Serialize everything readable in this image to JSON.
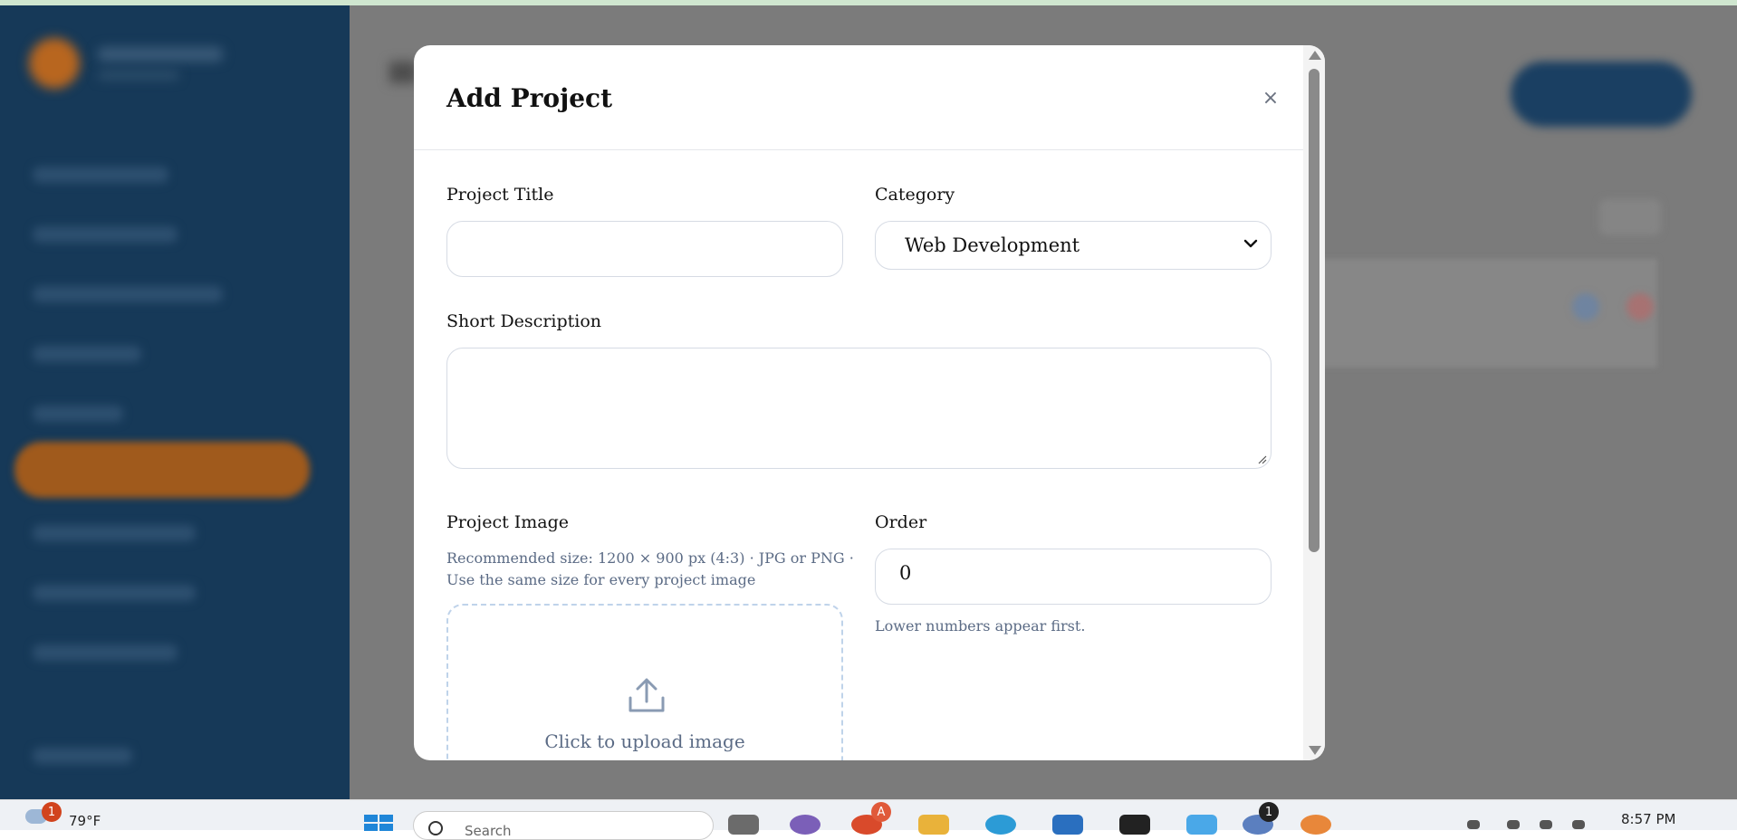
{
  "modal": {
    "title": "Add Project",
    "close_icon": "×",
    "fields": {
      "project_title": {
        "label": "Project Title",
        "value": ""
      },
      "category": {
        "label": "Category",
        "value": "Web Development"
      },
      "short_description": {
        "label": "Short Description",
        "value": ""
      },
      "project_image": {
        "label": "Project Image",
        "hint_line1": "Recommended size: 1200 × 900 px (4:3) · JPG or PNG ·",
        "hint_line2": "Use the same size for every project image",
        "upload_text": "Click to upload image"
      },
      "order": {
        "label": "Order",
        "value": "0",
        "hint": "Lower numbers appear first."
      }
    }
  },
  "taskbar": {
    "weather": {
      "temp": "79°F",
      "badge": "1"
    },
    "search_placeholder": "Search",
    "chrome_badge": "A",
    "app_badge": "1",
    "time": "8:57 PM"
  }
}
